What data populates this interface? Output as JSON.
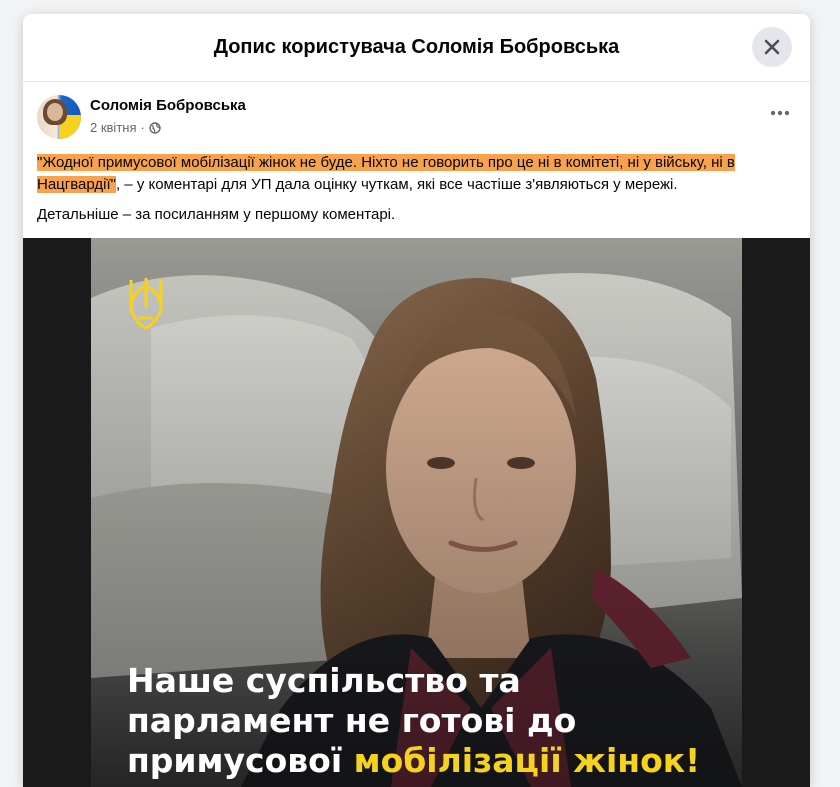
{
  "dialog": {
    "title": "Допис користувача Соломія Бобровська"
  },
  "post": {
    "author": "Соломія Бобровська",
    "date": "2 квітня",
    "separator": "·",
    "privacy_icon": "globe-icon",
    "more_icon": "more-options-icon",
    "quote": "\"Жодної примусової мобілізації жінок не буде. Ніхто не говорить про це ні в комітеті, ні у війську, ні в Нацгвардії\"",
    "text_after_quote": ", – у коментарі для УП дала оцінку чуткам, які все частіше з'являються у мережі.",
    "second_paragraph": "Детальніше – за посиланням у першому коментарі."
  },
  "image": {
    "caption_line1": "Наше суспільство та",
    "caption_line2": "парламент не готові до",
    "caption_line3_white": "примусової ",
    "caption_line3_yellow": "мобілізації жінок!",
    "emblem_icon": "tryzub-icon"
  },
  "colors": {
    "highlight": "#f9a24e",
    "caption_accent": "#f5d21e"
  }
}
